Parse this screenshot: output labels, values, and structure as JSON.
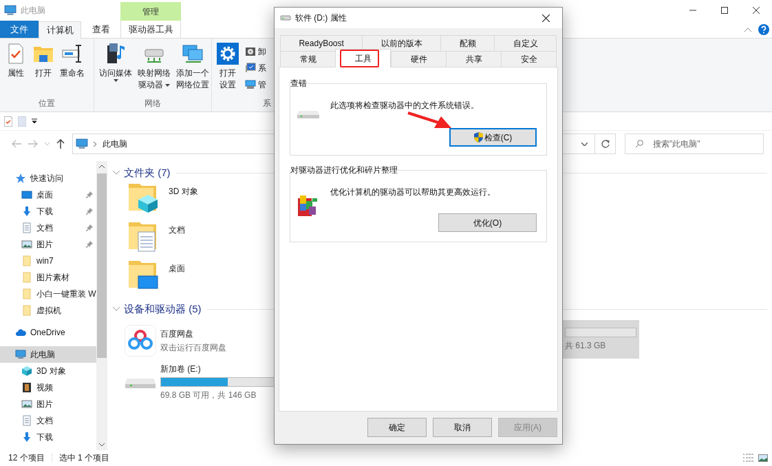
{
  "explorer": {
    "title": "此电脑",
    "contextual_header": "管理",
    "ribbon_tabs": [
      {
        "label": "文件",
        "kind": "file",
        "selected": false
      },
      {
        "label": "计算机",
        "kind": "tab",
        "selected": true
      },
      {
        "label": "查看",
        "kind": "tab",
        "selected": false
      },
      {
        "label": "驱动器工具",
        "kind": "contextual",
        "selected": false
      }
    ],
    "ribbon_groups": [
      {
        "label": "位置",
        "items": [
          {
            "lines": [
              "属性"
            ],
            "kind": "properties",
            "dropdown": false
          },
          {
            "lines": [
              "打开"
            ],
            "kind": "open",
            "dropdown": false
          },
          {
            "lines": [
              "重命名"
            ],
            "kind": "rename",
            "dropdown": false
          }
        ]
      },
      {
        "label": "网络",
        "items": [
          {
            "lines": [
              "访问媒体"
            ],
            "kind": "media",
            "dropdown": true
          },
          {
            "lines": [
              "映射网络",
              "驱动器"
            ],
            "kind": "map",
            "dropdown": true
          },
          {
            "lines": [
              "添加一个",
              "网络位置"
            ],
            "kind": "location",
            "dropdown": false
          }
        ]
      },
      {
        "label": "系",
        "items": [
          {
            "lines": [
              "打开",
              "设置"
            ],
            "kind": "settings",
            "dropdown": false
          }
        ],
        "small_items": [
          {
            "label": "卸",
            "kind": "uninstall"
          },
          {
            "label": "系",
            "kind": "system"
          },
          {
            "label": "管",
            "kind": "manage"
          }
        ]
      }
    ],
    "address": {
      "path": "此电脑"
    },
    "search": {
      "placeholder": "搜索\"此电脑\""
    },
    "nav": [
      {
        "label": "快速访问",
        "kind": "star",
        "pinned": false,
        "selected": false,
        "children": [
          {
            "label": "桌面",
            "kind": "desktop",
            "pinned": true,
            "selected": false
          },
          {
            "label": "下载",
            "kind": "download",
            "pinned": true,
            "selected": false
          },
          {
            "label": "文档",
            "kind": "document",
            "pinned": true,
            "selected": false
          },
          {
            "label": "图片",
            "kind": "picture",
            "pinned": true,
            "selected": false
          },
          {
            "label": "win7",
            "kind": "folder",
            "pinned": false,
            "selected": false
          },
          {
            "label": "图片素材",
            "kind": "folder",
            "pinned": false,
            "selected": false
          },
          {
            "label": "小白一键重装 W",
            "kind": "folder",
            "pinned": false,
            "selected": false
          },
          {
            "label": "虚拟机",
            "kind": "folder",
            "pinned": false,
            "selected": false
          }
        ]
      },
      {
        "label": "OneDrive",
        "kind": "onedrive",
        "pinned": false,
        "selected": false
      },
      {
        "label": "此电脑",
        "kind": "pc",
        "pinned": false,
        "selected": true,
        "children": [
          {
            "label": "3D 对象",
            "kind": "cube",
            "pinned": false,
            "selected": false
          },
          {
            "label": "视频",
            "kind": "video",
            "pinned": false,
            "selected": false
          },
          {
            "label": "图片",
            "kind": "picture",
            "pinned": false,
            "selected": false
          },
          {
            "label": "文档",
            "kind": "document",
            "pinned": false,
            "selected": false
          },
          {
            "label": "下载",
            "kind": "download",
            "pinned": false,
            "selected": false
          }
        ]
      }
    ],
    "sections": [
      {
        "title": "文件夹 (7)",
        "kind": "folders",
        "expanded": true,
        "items": [
          {
            "name": "3D 对象",
            "kind": "cube"
          },
          {
            "name": "文档",
            "kind": "document"
          },
          {
            "name": "桌面",
            "kind": "desktop"
          }
        ]
      },
      {
        "title": "设备和驱动器 (5)",
        "kind": "tiles",
        "expanded": true,
        "items": [
          {
            "name": "百度网盘",
            "kind": "app",
            "subtitle": "双击运行百度网盘",
            "selected": false
          },
          {
            "kind": "partial",
            "detail": "共 61.3 GB",
            "selected": true
          },
          {
            "name": "新加卷 (E:)",
            "kind": "drive",
            "level": 0.52,
            "detail": "69.8 GB 可用，共 146 GB",
            "selected": false
          }
        ]
      }
    ],
    "status_bar": {
      "item_count": "12 个项目",
      "selection": "选中 1 个项目"
    }
  },
  "dialog": {
    "title": "软件 (D:) 属性",
    "tab_rows": [
      [
        {
          "label": "ReadyBoost",
          "selected": false,
          "highlighted": false
        },
        {
          "label": "以前的版本",
          "selected": false,
          "highlighted": false
        },
        {
          "label": "配额",
          "selected": false,
          "highlighted": false
        },
        {
          "label": "自定义",
          "selected": false,
          "highlighted": false
        }
      ],
      [
        {
          "label": "常规",
          "selected": false,
          "highlighted": false
        },
        {
          "label": "工具",
          "selected": true,
          "highlighted": true
        },
        {
          "label": "硬件",
          "selected": false,
          "highlighted": false
        },
        {
          "label": "共享",
          "selected": false,
          "highlighted": false
        },
        {
          "label": "安全",
          "selected": false,
          "highlighted": false
        }
      ]
    ],
    "groups": [
      {
        "title": "查错",
        "kind": "drive",
        "text": "此选项将检查驱动器中的文件系统错误。",
        "button": {
          "label": "检查(C)",
          "shield": true,
          "focused": true,
          "highlighted": true
        }
      },
      {
        "title": "对驱动器进行优化和碎片整理",
        "kind": "defrag",
        "text": "优化计算机的驱动器可以帮助其更高效运行。",
        "button": {
          "label": "优化(O)",
          "shield": false,
          "focused": false,
          "highlighted": false
        }
      }
    ],
    "buttons": [
      {
        "label": "确定",
        "disabled": false
      },
      {
        "label": "取消",
        "disabled": false
      },
      {
        "label": "应用(A)",
        "disabled": true
      }
    ]
  }
}
